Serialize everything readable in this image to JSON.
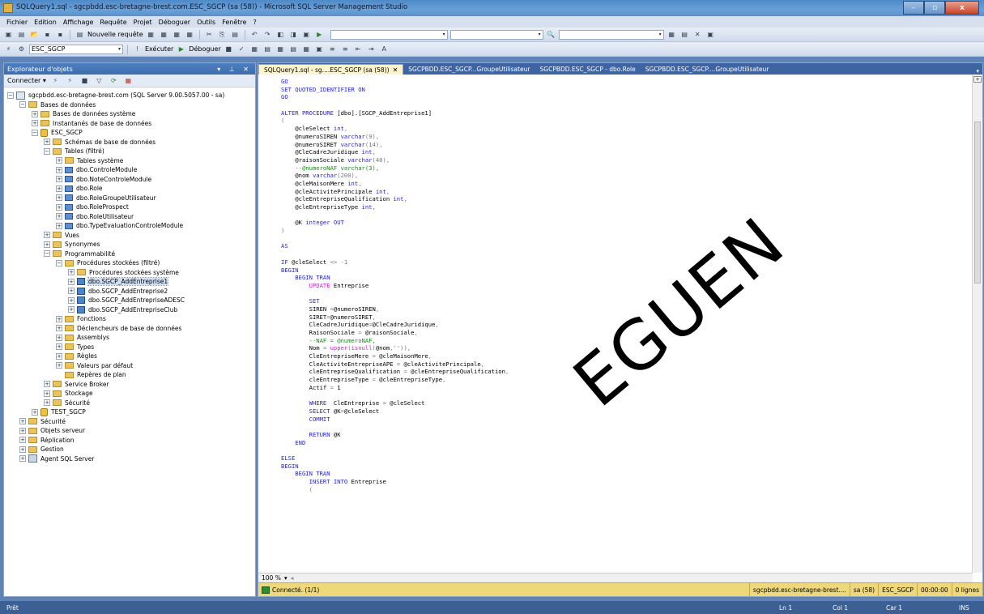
{
  "window": {
    "title": "SQLQuery1.sql - sgcpbdd.esc-bretagne-brest.com.ESC_SGCP (sa (58)) - Microsoft SQL Server Management Studio",
    "controls": {
      "minimize": "–",
      "maximize": "▫",
      "close": "x"
    }
  },
  "menu": [
    "Fichier",
    "Edition",
    "Affichage",
    "Requête",
    "Projet",
    "Déboguer",
    "Outils",
    "Fenêtre",
    "?"
  ],
  "toolbar1": {
    "new_query": "Nouvelle requête"
  },
  "toolbar2": {
    "database_value": "ESC_SGCP",
    "execute": "Exécuter",
    "debug": "Déboguer"
  },
  "explorer": {
    "title": "Explorateur d'objets",
    "pin": "▾ ⊥ ✕",
    "connect": "Connecter",
    "tree": [
      {
        "label": "sgcpbdd.esc-bretagne-brest.com (SQL Server 9.00.5057.00 - sa)",
        "level": 0,
        "exp": "−",
        "icon": "server"
      },
      {
        "label": "Bases de données",
        "level": 1,
        "exp": "−",
        "icon": "folder"
      },
      {
        "label": "Bases de données système",
        "level": 2,
        "exp": "+",
        "icon": "folder"
      },
      {
        "label": "Instantanés de base de données",
        "level": 2,
        "exp": "+",
        "icon": "folder"
      },
      {
        "label": "ESC_SGCP",
        "level": 2,
        "exp": "−",
        "icon": "db"
      },
      {
        "label": "Schémas de base de données",
        "level": 3,
        "exp": "+",
        "icon": "folder"
      },
      {
        "label": "Tables (filtré)",
        "level": 3,
        "exp": "−",
        "icon": "folder"
      },
      {
        "label": "Tables système",
        "level": 4,
        "exp": "+",
        "icon": "folder"
      },
      {
        "label": "dbo.ControleModule",
        "level": 4,
        "exp": "+",
        "icon": "table"
      },
      {
        "label": "dbo.NoteControleModule",
        "level": 4,
        "exp": "+",
        "icon": "table"
      },
      {
        "label": "dbo.Role",
        "level": 4,
        "exp": "+",
        "icon": "table"
      },
      {
        "label": "dbo.RoleGroupeUtilisateur",
        "level": 4,
        "exp": "+",
        "icon": "table"
      },
      {
        "label": "dbo.RoleProspect",
        "level": 4,
        "exp": "+",
        "icon": "table"
      },
      {
        "label": "dbo.RoleUtilisateur",
        "level": 4,
        "exp": "+",
        "icon": "table"
      },
      {
        "label": "dbo.TypeEvaluationControleModule",
        "level": 4,
        "exp": "+",
        "icon": "table"
      },
      {
        "label": "Vues",
        "level": 3,
        "exp": "+",
        "icon": "folder"
      },
      {
        "label": "Synonymes",
        "level": 3,
        "exp": "+",
        "icon": "folder"
      },
      {
        "label": "Programmabilité",
        "level": 3,
        "exp": "−",
        "icon": "folder"
      },
      {
        "label": "Procédures stockées (filtré)",
        "level": 4,
        "exp": "−",
        "icon": "folder"
      },
      {
        "label": "Procédures stockées système",
        "level": 5,
        "exp": "+",
        "icon": "folder"
      },
      {
        "label": "dbo.SGCP_AddEntreprise1",
        "level": 5,
        "exp": "+",
        "icon": "proc",
        "selected": true
      },
      {
        "label": "dbo.SGCP_AddEntreprise2",
        "level": 5,
        "exp": "+",
        "icon": "proc"
      },
      {
        "label": "dbo.SGCP_AddEntrepriseADESC",
        "level": 5,
        "exp": "+",
        "icon": "proc"
      },
      {
        "label": "dbo.SGCP_AddEntrepriseClub",
        "level": 5,
        "exp": "+",
        "icon": "proc"
      },
      {
        "label": "Fonctions",
        "level": 4,
        "exp": "+",
        "icon": "folder"
      },
      {
        "label": "Déclencheurs de base de données",
        "level": 4,
        "exp": "+",
        "icon": "folder"
      },
      {
        "label": "Assemblys",
        "level": 4,
        "exp": "+",
        "icon": "folder"
      },
      {
        "label": "Types",
        "level": 4,
        "exp": "+",
        "icon": "folder"
      },
      {
        "label": "Règles",
        "level": 4,
        "exp": "+",
        "icon": "folder"
      },
      {
        "label": "Valeurs par défaut",
        "level": 4,
        "exp": "+",
        "icon": "folder"
      },
      {
        "label": "Repères de plan",
        "level": 4,
        "exp": "",
        "icon": "folder"
      },
      {
        "label": "Service Broker",
        "level": 3,
        "exp": "+",
        "icon": "folder"
      },
      {
        "label": "Stockage",
        "level": 3,
        "exp": "+",
        "icon": "folder"
      },
      {
        "label": "Sécurité",
        "level": 3,
        "exp": "+",
        "icon": "folder"
      },
      {
        "label": "TEST_SGCP",
        "level": 2,
        "exp": "+",
        "icon": "db"
      },
      {
        "label": "Sécurité",
        "level": 1,
        "exp": "+",
        "icon": "folder"
      },
      {
        "label": "Objets serveur",
        "level": 1,
        "exp": "+",
        "icon": "folder"
      },
      {
        "label": "Réplication",
        "level": 1,
        "exp": "+",
        "icon": "folder"
      },
      {
        "label": "Gestion",
        "level": 1,
        "exp": "+",
        "icon": "folder"
      },
      {
        "label": "Agent SQL Server",
        "level": 1,
        "exp": "+",
        "icon": "agent"
      }
    ]
  },
  "tabs": [
    {
      "label": "SQLQuery1.sql - sg....ESC_SGCP (sa (58))",
      "active": true,
      "close": "✕"
    },
    {
      "label": "SGCPBDD.ESC_SGCP...GroupeUtilisateur",
      "active": false
    },
    {
      "label": "SGCPBDD.ESC_SGCP - dbo.Role",
      "active": false
    },
    {
      "label": "SGCPBDD.ESC_SGCP....GroupeUtilisateur",
      "active": false
    }
  ],
  "code_lines": [
    [
      [
        "kw",
        "GO"
      ]
    ],
    [
      [
        "kw",
        "SET QUOTED_IDENTIFIER ON"
      ]
    ],
    [
      [
        "kw",
        "GO"
      ]
    ],
    [],
    [
      [
        "kw",
        "ALTER PROCEDURE "
      ],
      [
        "var",
        "[dbo].[SGCP_AddEntreprise1]"
      ]
    ],
    [
      [
        "gray",
        "("
      ]
    ],
    [
      [
        "var",
        "    @cleSelect "
      ],
      [
        "kw",
        "int"
      ],
      [
        "gray",
        ","
      ]
    ],
    [
      [
        "var",
        "    @numeroSIREN "
      ],
      [
        "kw",
        "varchar"
      ],
      [
        "gray",
        "(9),"
      ]
    ],
    [
      [
        "var",
        "    @numeroSIRET "
      ],
      [
        "kw",
        "varchar"
      ],
      [
        "gray",
        "(14),"
      ]
    ],
    [
      [
        "var",
        "    @CleCadreJuridique "
      ],
      [
        "kw",
        "int"
      ],
      [
        "gray",
        ","
      ]
    ],
    [
      [
        "var",
        "    @raisonSociale "
      ],
      [
        "kw",
        "varchar"
      ],
      [
        "gray",
        "(40),"
      ]
    ],
    [
      [
        "cm",
        "    --@numeroNAF varchar(3),"
      ]
    ],
    [
      [
        "var",
        "    @nom "
      ],
      [
        "kw",
        "varchar"
      ],
      [
        "gray",
        "(200),"
      ]
    ],
    [
      [
        "var",
        "    @cleMaisonMere "
      ],
      [
        "kw",
        "int"
      ],
      [
        "gray",
        ","
      ]
    ],
    [
      [
        "var",
        "    @cleActivitePrincipale "
      ],
      [
        "kw",
        "int"
      ],
      [
        "gray",
        ","
      ]
    ],
    [
      [
        "var",
        "    @cleEntrepriseQualification "
      ],
      [
        "kw",
        "int"
      ],
      [
        "gray",
        ","
      ]
    ],
    [
      [
        "var",
        "    @cleEntrepriseType "
      ],
      [
        "kw",
        "int"
      ],
      [
        "gray",
        ","
      ]
    ],
    [],
    [
      [
        "var",
        "    @K "
      ],
      [
        "kw",
        "integer OUT"
      ]
    ],
    [
      [
        "gray",
        ")"
      ]
    ],
    [],
    [
      [
        "kw",
        "AS"
      ]
    ],
    [],
    [
      [
        "kw",
        "IF "
      ],
      [
        "var",
        "@cleSelect "
      ],
      [
        "gray",
        "<> -1"
      ]
    ],
    [
      [
        "kw",
        "BEGIN"
      ]
    ],
    [
      [
        "kw",
        "    BEGIN TRAN"
      ]
    ],
    [
      [
        "upd",
        "        UPDATE "
      ],
      [
        "var",
        "Entreprise"
      ]
    ],
    [],
    [
      [
        "kw",
        "        SET"
      ]
    ],
    [
      [
        "var",
        "        SIREN "
      ],
      [
        "gray",
        "="
      ],
      [
        "var",
        "@numeroSIREN"
      ],
      [
        "gray",
        ","
      ]
    ],
    [
      [
        "var",
        "        SIRET"
      ],
      [
        "gray",
        "="
      ],
      [
        "var",
        "@numeroSIRET"
      ],
      [
        "gray",
        ","
      ]
    ],
    [
      [
        "var",
        "        CleCadreJuridique"
      ],
      [
        "gray",
        "="
      ],
      [
        "var",
        "@CleCadreJuridique"
      ],
      [
        "gray",
        ","
      ]
    ],
    [
      [
        "var",
        "        RaisonSociale "
      ],
      [
        "gray",
        "= "
      ],
      [
        "var",
        "@raisonSociale"
      ],
      [
        "gray",
        ","
      ]
    ],
    [
      [
        "cm",
        "        --NAF = @numeroNAF,"
      ]
    ],
    [
      [
        "var",
        "        Nom "
      ],
      [
        "gray",
        "= "
      ],
      [
        "fn",
        "upper"
      ],
      [
        "gray",
        "("
      ],
      [
        "fn",
        "isnull"
      ],
      [
        "gray",
        "("
      ],
      [
        "var",
        "@nom"
      ],
      [
        "gray",
        ",'')),"
      ]
    ],
    [
      [
        "var",
        "        CleEntrepriseMere "
      ],
      [
        "gray",
        "= "
      ],
      [
        "var",
        "@cleMaisonMere"
      ],
      [
        "gray",
        ","
      ]
    ],
    [
      [
        "var",
        "        CleActiviteEntrepriseAPE "
      ],
      [
        "gray",
        "= "
      ],
      [
        "var",
        "@cleActivitePrincipale"
      ],
      [
        "gray",
        ","
      ]
    ],
    [
      [
        "var",
        "        cleEntrepriseQualification "
      ],
      [
        "gray",
        "= "
      ],
      [
        "var",
        "@cleEntrepriseQualification"
      ],
      [
        "gray",
        ","
      ]
    ],
    [
      [
        "var",
        "        cleEntrepriseType "
      ],
      [
        "gray",
        "= "
      ],
      [
        "var",
        "@cleEntrepriseType"
      ],
      [
        "gray",
        ","
      ]
    ],
    [
      [
        "var",
        "        Actif "
      ],
      [
        "gray",
        "= "
      ],
      [
        "var",
        "1"
      ]
    ],
    [],
    [
      [
        "kw",
        "        WHERE  "
      ],
      [
        "var",
        "CleEntreprise "
      ],
      [
        "gray",
        "= "
      ],
      [
        "var",
        "@cleSelect"
      ]
    ],
    [
      [
        "kw",
        "        SELECT "
      ],
      [
        "var",
        "@K"
      ],
      [
        "gray",
        "="
      ],
      [
        "var",
        "@cleSelect"
      ]
    ],
    [
      [
        "kw",
        "        COMMIT"
      ]
    ],
    [],
    [
      [
        "kw",
        "        RETURN "
      ],
      [
        "var",
        "@K"
      ]
    ],
    [
      [
        "kw",
        "    END"
      ]
    ],
    [],
    [
      [
        "kw",
        "ELSE"
      ]
    ],
    [
      [
        "kw",
        "BEGIN"
      ]
    ],
    [
      [
        "kw",
        "    BEGIN TRAN"
      ]
    ],
    [
      [
        "kw",
        "        INSERT INTO "
      ],
      [
        "var",
        "Entreprise"
      ]
    ],
    [
      [
        "gray",
        "        ("
      ]
    ]
  ],
  "zoom": {
    "value": "100 %"
  },
  "connection": {
    "status": "Connecté. (1/1)",
    "server": "sgcpbdd.esc-bretagne-brest....",
    "user": "sa (58)",
    "database": "ESC_SGCP",
    "time": "00:00:00",
    "rows": "0 lignes"
  },
  "status": {
    "message": "Prêt",
    "ln": "Ln 1",
    "col": "Col 1",
    "car": "Car 1",
    "ins": "INS"
  },
  "watermark": "EGUEN"
}
